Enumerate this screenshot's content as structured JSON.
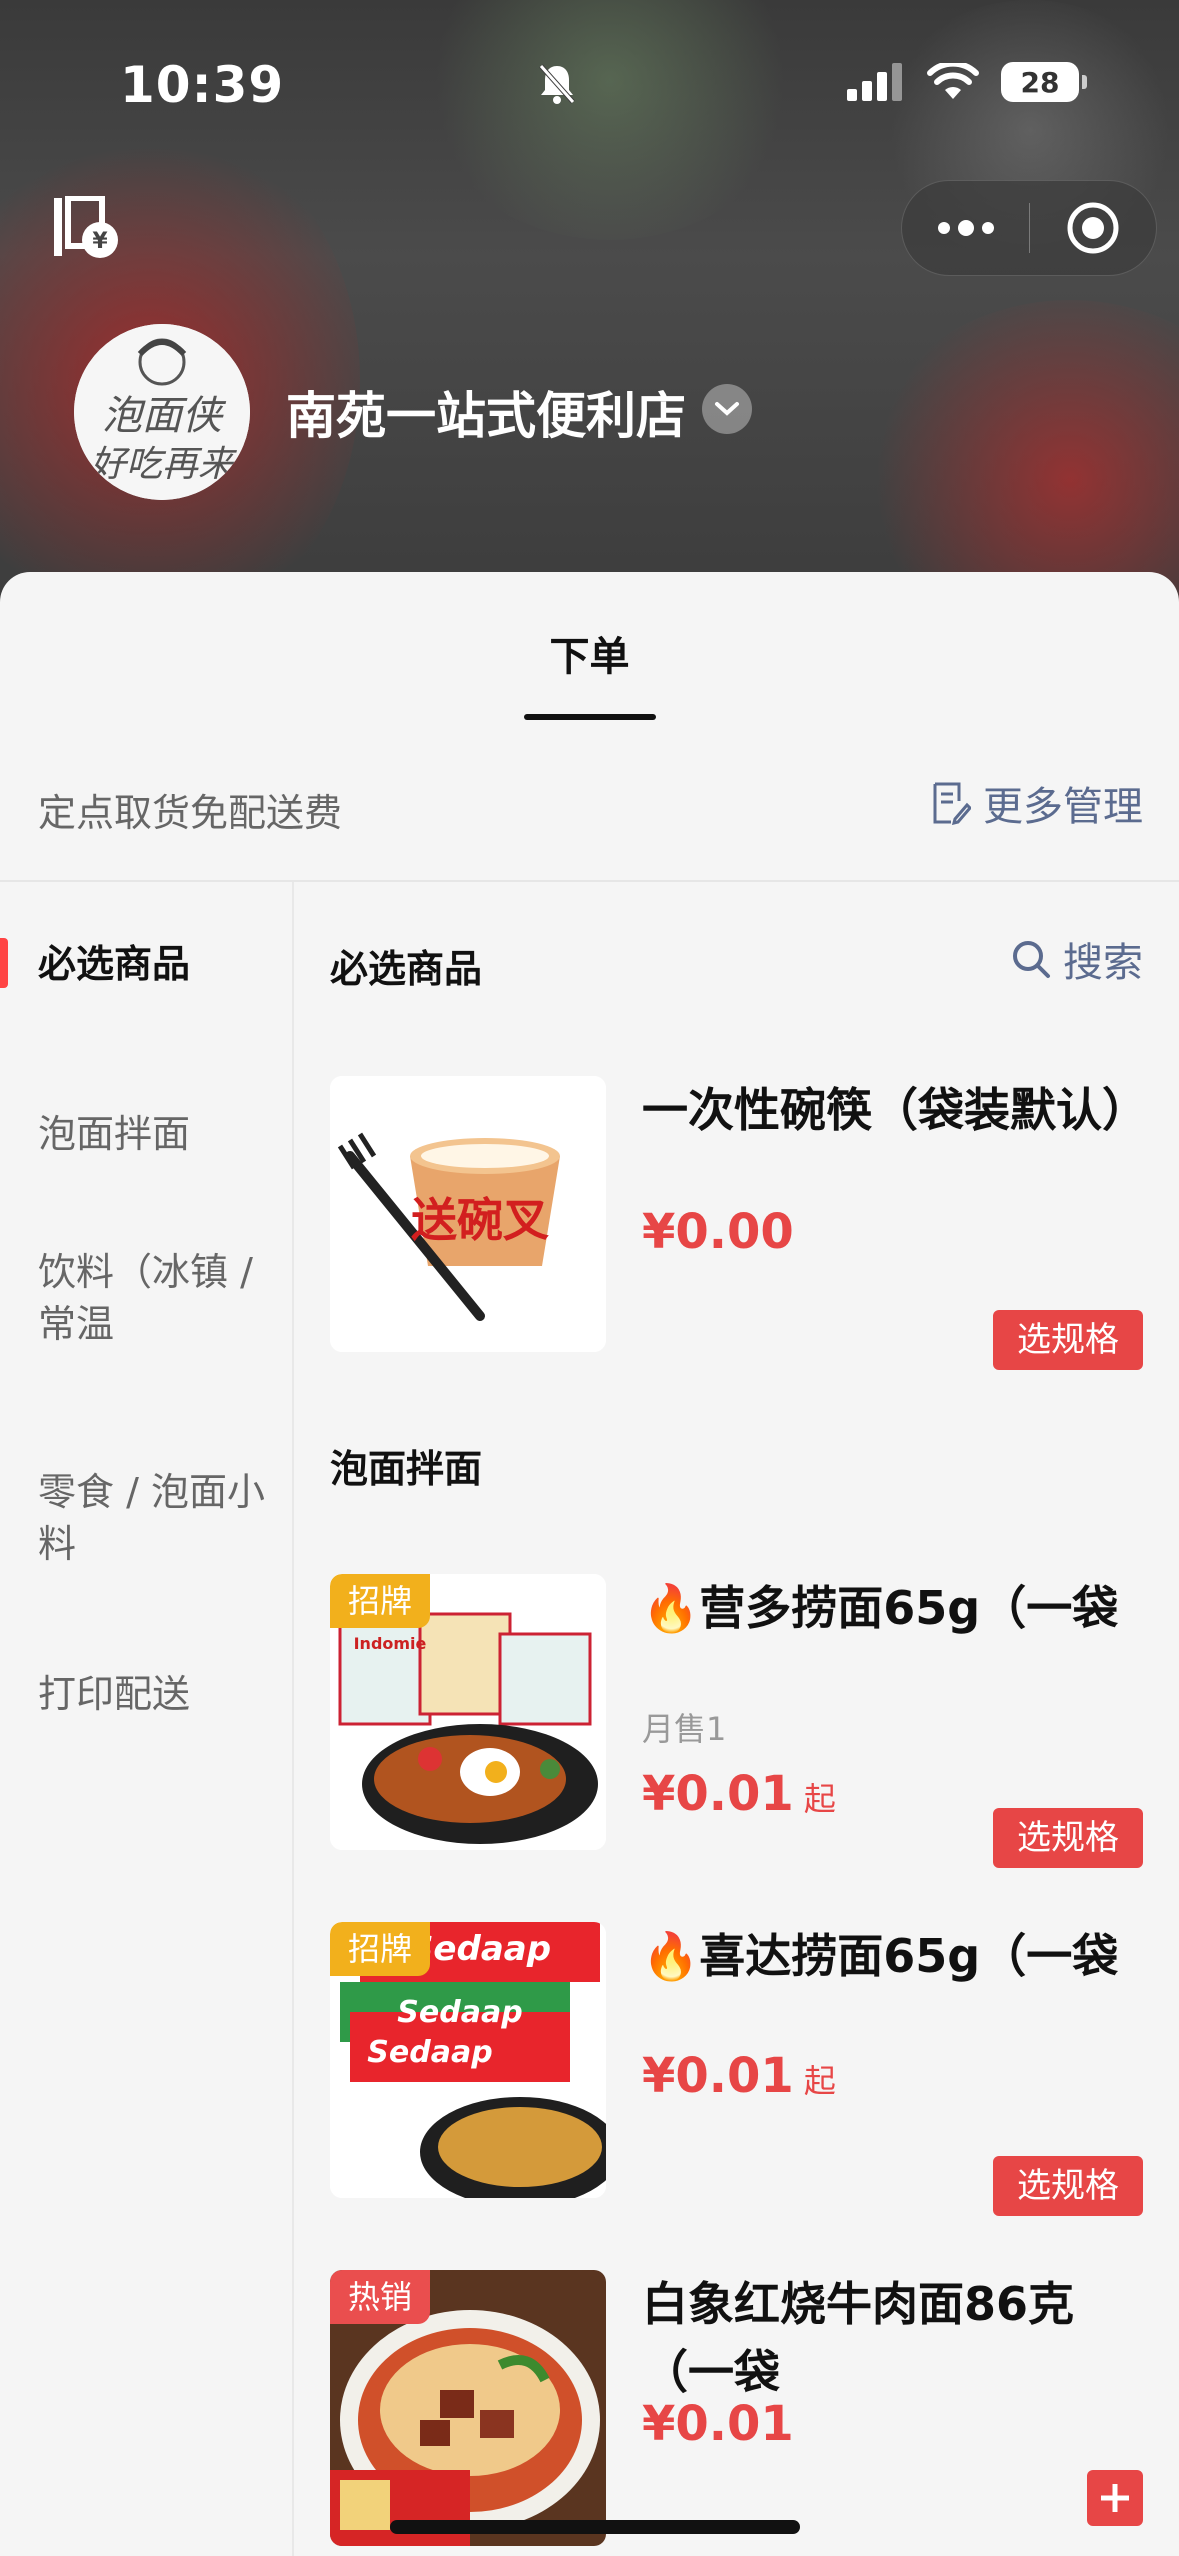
{
  "status_bar": {
    "time": "10:39",
    "battery": "28"
  },
  "store": {
    "name": "南苑一站式便利店",
    "avatar_text_top": "泡面侠",
    "avatar_text_bottom": "好吃再来"
  },
  "tabs": [
    {
      "label": "下单",
      "active": true
    }
  ],
  "notice": "定点取货免配送费",
  "more_manage_label": "更多管理",
  "search_label": "搜索",
  "sidebar": {
    "items": [
      {
        "label": "必选商品",
        "active": true
      },
      {
        "label": "泡面拌面",
        "active": false
      },
      {
        "label": "饮料（冰镇 / 常温",
        "active": false
      },
      {
        "label": "零食 / 泡面小料",
        "active": false
      },
      {
        "label": "打印配送",
        "active": false
      }
    ]
  },
  "sections": [
    {
      "title": "必选商品",
      "products": [
        {
          "name": "一次性碗筷（袋装默认）",
          "price": "¥0.00",
          "action": "选规格",
          "image_text": "送碗叉"
        }
      ]
    },
    {
      "title": "泡面拌面",
      "products": [
        {
          "name": "🔥营多捞面65g（一袋",
          "badge": "招牌",
          "sold": "月售1",
          "price": "¥0.01",
          "price_suffix": "起",
          "action": "选规格",
          "image_brand": "Indomie"
        },
        {
          "name": "🔥喜达捞面65g（一袋",
          "badge": "招牌",
          "price": "¥0.01",
          "price_suffix": "起",
          "action": "选规格",
          "image_brand": "Sedaap"
        },
        {
          "name": "白象红烧牛肉面86克（一袋",
          "badge": "热销",
          "price": "¥0.01"
        }
      ]
    }
  ],
  "colors": {
    "accent_red": "#e74646",
    "badge_gold": "#f2b01c",
    "link_blue": "#5b6b8f"
  }
}
